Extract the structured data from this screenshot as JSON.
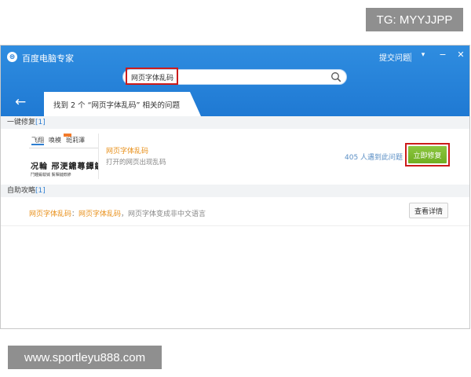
{
  "watermarks": {
    "top": "TG: MYYJJPP",
    "bottom": "www.sportleyu888.com"
  },
  "titlebar": {
    "logo_glyph": "⊜",
    "app_title": "百度电脑专家",
    "feedback": "提交问题",
    "menu_glyph": "▾",
    "minimize_glyph": "−",
    "close_glyph": "✕"
  },
  "search": {
    "value": "网页字体乱码",
    "icon": "search-icon"
  },
  "results": {
    "back_glyph": "←",
    "summary": "找到 2 个 “网页字体乱码” 相关的问题"
  },
  "one_key_fix": {
    "section_label": "一键修复",
    "count": "[1]",
    "thumbnail": {
      "tabs": [
        "飞翔",
        "唤模",
        "斑莉澤"
      ],
      "glyphs": "况輪  郉浭鐤蕁鐔鏞",
      "small_text": "鬥鍾鍜韍铖  鬀賱鏈錞鏒"
    },
    "title": "网页字体乱码",
    "description": "打开的网页出现乱码",
    "count_text": "405 人遇到此问题",
    "fix_button": "立即修复"
  },
  "self_help": {
    "section_label": "自助攻略",
    "count": "[1]",
    "item": {
      "title": "网页字体乱码",
      "separator": "：",
      "link": "网页字体乱码",
      "description": "，网页字体变成非中文语言"
    },
    "detail_button": "查看详情"
  },
  "colors": {
    "titlebar": "#2583d8",
    "accent_orange": "#e8901a",
    "fix_button": "#7cb82f",
    "highlight_red": "#cc1b1b"
  }
}
